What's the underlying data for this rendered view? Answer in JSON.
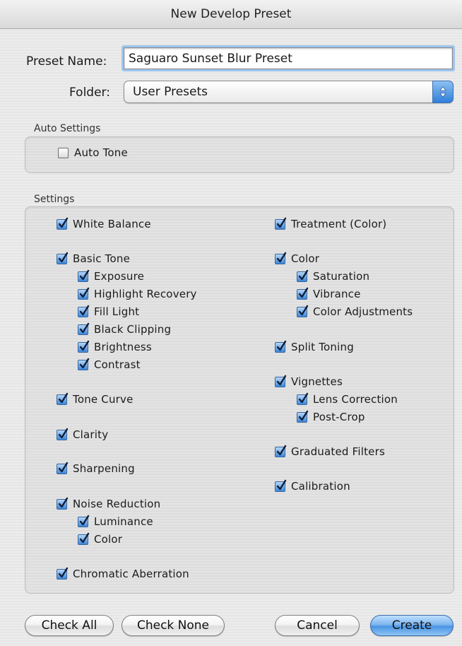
{
  "window": {
    "title": "New Develop Preset"
  },
  "form": {
    "preset_name_label": "Preset Name:",
    "preset_name_value": "Saguaro Sunset Blur Preset",
    "folder_label": "Folder:",
    "folder_value": "User Presets"
  },
  "auto_settings": {
    "label": "Auto Settings",
    "auto_tone": {
      "label": "Auto Tone",
      "checked": false
    }
  },
  "settings": {
    "label": "Settings",
    "left": [
      {
        "label": "White Balance",
        "checked": true
      },
      {
        "label": "Basic Tone",
        "checked": true
      },
      {
        "label": "Exposure",
        "checked": true
      },
      {
        "label": "Highlight Recovery",
        "checked": true
      },
      {
        "label": "Fill Light",
        "checked": true
      },
      {
        "label": "Black Clipping",
        "checked": true
      },
      {
        "label": "Brightness",
        "checked": true
      },
      {
        "label": "Contrast",
        "checked": true
      },
      {
        "label": "Tone Curve",
        "checked": true
      },
      {
        "label": "Clarity",
        "checked": true
      },
      {
        "label": "Sharpening",
        "checked": true
      },
      {
        "label": "Noise Reduction",
        "checked": true
      },
      {
        "label": "Luminance",
        "checked": true
      },
      {
        "label": "Color",
        "checked": true
      },
      {
        "label": "Chromatic Aberration",
        "checked": true
      }
    ],
    "right": [
      {
        "label": "Treatment (Color)",
        "checked": true
      },
      {
        "label": "Color",
        "checked": true
      },
      {
        "label": "Saturation",
        "checked": true
      },
      {
        "label": "Vibrance",
        "checked": true
      },
      {
        "label": "Color Adjustments",
        "checked": true
      },
      {
        "label": "Split Toning",
        "checked": true
      },
      {
        "label": "Vignettes",
        "checked": true
      },
      {
        "label": "Lens Correction",
        "checked": true
      },
      {
        "label": "Post-Crop",
        "checked": true
      },
      {
        "label": "Graduated Filters",
        "checked": true
      },
      {
        "label": "Calibration",
        "checked": true
      }
    ]
  },
  "buttons": {
    "check_all": "Check All",
    "check_none": "Check None",
    "cancel": "Cancel",
    "create": "Create"
  },
  "colors": {
    "accent": "#4b94e3",
    "focus_ring": "#9ec5ef"
  }
}
